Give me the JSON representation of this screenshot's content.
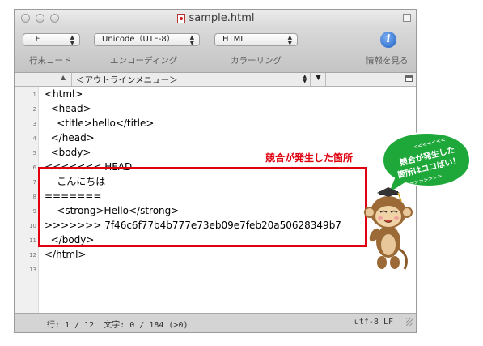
{
  "window": {
    "title": "sample.html"
  },
  "toolbar": {
    "line_ending": {
      "value": "LF",
      "label": "行末コード"
    },
    "encoding": {
      "value": "Unicode（UTF-8）",
      "label": "エンコーディング"
    },
    "coloring": {
      "value": "HTML",
      "label": "カラーリング"
    },
    "info": {
      "label": "情報を見る",
      "icon": "info-icon"
    }
  },
  "navbar": {
    "outline": "＜アウトラインメニュー＞"
  },
  "editor": {
    "lines": [
      {
        "num": "1",
        "text": "<html>"
      },
      {
        "num": "2",
        "text": "  <head>"
      },
      {
        "num": "3",
        "text": "    <title>hello</title>"
      },
      {
        "num": "4",
        "text": "  </head>"
      },
      {
        "num": "5",
        "text": "  <body>"
      },
      {
        "num": "6",
        "text": "<<<<<<< HEAD"
      },
      {
        "num": "7",
        "text": "    こんにちは"
      },
      {
        "num": "8",
        "text": "======="
      },
      {
        "num": "9",
        "text": "    <strong>Hello</strong>"
      },
      {
        "num": "10",
        "text": ">>>>>>> 7f46c6f77b4b777e73eb09e7feb20a50628349b7"
      },
      {
        "num": "11",
        "text": "  </body>"
      },
      {
        "num": "12",
        "text": "</html>"
      },
      {
        "num": "13",
        "text": ""
      }
    ]
  },
  "statusbar": {
    "position": "行: 1 / 12  文字: 0 / 184 (>0)",
    "encoding": "utf-8 LF"
  },
  "annotation": {
    "conflict_label": "競合が発生した箇所",
    "bubble_line1": "競合が発生した",
    "bubble_line2": "箇所はココばい！",
    "bubble_deco_top": "<<<<<<<",
    "bubble_deco_bottom": ">>>>>>>",
    "accent": "#e00010"
  }
}
